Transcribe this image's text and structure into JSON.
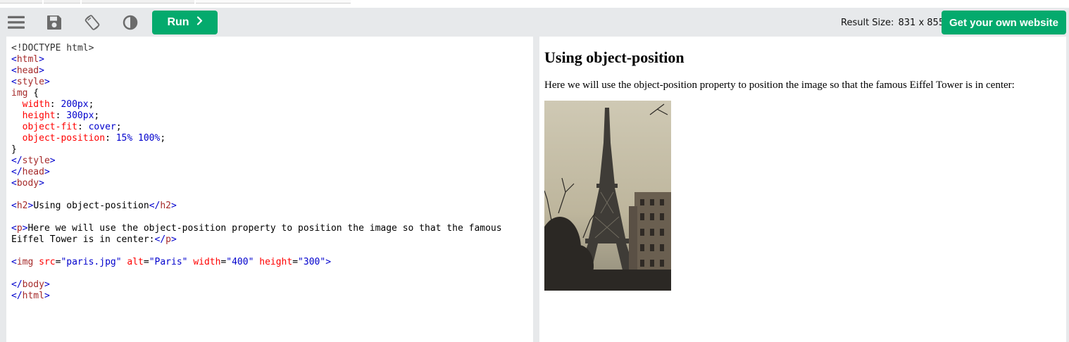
{
  "toolbar": {
    "menu_icon": "hamburger-menu-icon",
    "save_icon": "floppy-save-icon",
    "rotate_icon": "rotate-orientation-icon",
    "theme_icon": "contrast-theme-icon",
    "run_label": "Run",
    "run_icon": "chevron-right-icon",
    "result_size_label": "Result Size:",
    "result_size_value": "831 x 855",
    "get_website_label": "Get your own website"
  },
  "editor": {
    "lines": [
      [
        {
          "t": "doc",
          "v": "<!DOCTYPE html>"
        }
      ],
      [
        {
          "t": "brk",
          "v": "<"
        },
        {
          "t": "tag",
          "v": "html"
        },
        {
          "t": "brk",
          "v": ">"
        }
      ],
      [
        {
          "t": "brk",
          "v": "<"
        },
        {
          "t": "tag",
          "v": "head"
        },
        {
          "t": "brk",
          "v": ">"
        }
      ],
      [
        {
          "t": "brk",
          "v": "<"
        },
        {
          "t": "tag",
          "v": "style"
        },
        {
          "t": "brk",
          "v": ">"
        }
      ],
      [
        {
          "t": "sel",
          "v": "img"
        },
        {
          "t": "plain",
          "v": " {"
        }
      ],
      [
        {
          "t": "plain",
          "v": "  "
        },
        {
          "t": "prop",
          "v": "width"
        },
        {
          "t": "plain",
          "v": ": "
        },
        {
          "t": "val",
          "v": "200px"
        },
        {
          "t": "plain",
          "v": ";"
        }
      ],
      [
        {
          "t": "plain",
          "v": "  "
        },
        {
          "t": "prop",
          "v": "height"
        },
        {
          "t": "plain",
          "v": ": "
        },
        {
          "t": "val",
          "v": "300px"
        },
        {
          "t": "plain",
          "v": ";"
        }
      ],
      [
        {
          "t": "plain",
          "v": "  "
        },
        {
          "t": "prop",
          "v": "object-fit"
        },
        {
          "t": "plain",
          "v": ": "
        },
        {
          "t": "val",
          "v": "cover"
        },
        {
          "t": "plain",
          "v": ";"
        }
      ],
      [
        {
          "t": "plain",
          "v": "  "
        },
        {
          "t": "prop",
          "v": "object-position"
        },
        {
          "t": "plain",
          "v": ": "
        },
        {
          "t": "val",
          "v": "15% 100%"
        },
        {
          "t": "plain",
          "v": ";"
        }
      ],
      [
        {
          "t": "plain",
          "v": "}"
        }
      ],
      [
        {
          "t": "brk",
          "v": "</"
        },
        {
          "t": "tag",
          "v": "style"
        },
        {
          "t": "brk",
          "v": ">"
        }
      ],
      [
        {
          "t": "brk",
          "v": "</"
        },
        {
          "t": "tag",
          "v": "head"
        },
        {
          "t": "brk",
          "v": ">"
        }
      ],
      [
        {
          "t": "brk",
          "v": "<"
        },
        {
          "t": "tag",
          "v": "body"
        },
        {
          "t": "brk",
          "v": ">"
        }
      ],
      [],
      [
        {
          "t": "brk",
          "v": "<"
        },
        {
          "t": "tag",
          "v": "h2"
        },
        {
          "t": "brk",
          "v": ">"
        },
        {
          "t": "plain",
          "v": "Using object-position"
        },
        {
          "t": "brk",
          "v": "</"
        },
        {
          "t": "tag",
          "v": "h2"
        },
        {
          "t": "brk",
          "v": ">"
        }
      ],
      [],
      [
        {
          "t": "brk",
          "v": "<"
        },
        {
          "t": "tag",
          "v": "p"
        },
        {
          "t": "brk",
          "v": ">"
        },
        {
          "t": "plain",
          "v": "Here we will use the object-position property to position the image so that the famous"
        }
      ],
      [
        {
          "t": "plain",
          "v": "Eiffel Tower is in center:"
        },
        {
          "t": "brk",
          "v": "</"
        },
        {
          "t": "tag",
          "v": "p"
        },
        {
          "t": "brk",
          "v": ">"
        }
      ],
      [],
      [
        {
          "t": "brk",
          "v": "<"
        },
        {
          "t": "tag",
          "v": "img"
        },
        {
          "t": "plain",
          "v": " "
        },
        {
          "t": "attr",
          "v": "src"
        },
        {
          "t": "plain",
          "v": "="
        },
        {
          "t": "val",
          "v": "\"paris.jpg\""
        },
        {
          "t": "plain",
          "v": " "
        },
        {
          "t": "attr",
          "v": "alt"
        },
        {
          "t": "plain",
          "v": "="
        },
        {
          "t": "val",
          "v": "\"Paris\""
        },
        {
          "t": "plain",
          "v": " "
        },
        {
          "t": "attr",
          "v": "width"
        },
        {
          "t": "plain",
          "v": "="
        },
        {
          "t": "val",
          "v": "\"400\""
        },
        {
          "t": "plain",
          "v": " "
        },
        {
          "t": "attr",
          "v": "height"
        },
        {
          "t": "plain",
          "v": "="
        },
        {
          "t": "val",
          "v": "\"300\""
        },
        {
          "t": "brk",
          "v": ">"
        }
      ],
      [],
      [
        {
          "t": "brk",
          "v": "</"
        },
        {
          "t": "tag",
          "v": "body"
        },
        {
          "t": "brk",
          "v": ">"
        }
      ],
      [
        {
          "t": "brk",
          "v": "</"
        },
        {
          "t": "tag",
          "v": "html"
        },
        {
          "t": "brk",
          "v": ">"
        }
      ]
    ]
  },
  "result": {
    "heading": "Using object-position",
    "paragraph": "Here we will use the object-position property to position the image so that the famous Eiffel Tower is in center:",
    "image_alt": "Paris"
  },
  "colors": {
    "accent_green": "#04aa6d",
    "toolbar_bg": "#e7e9eb",
    "icon_gray": "#6b6b6b"
  }
}
